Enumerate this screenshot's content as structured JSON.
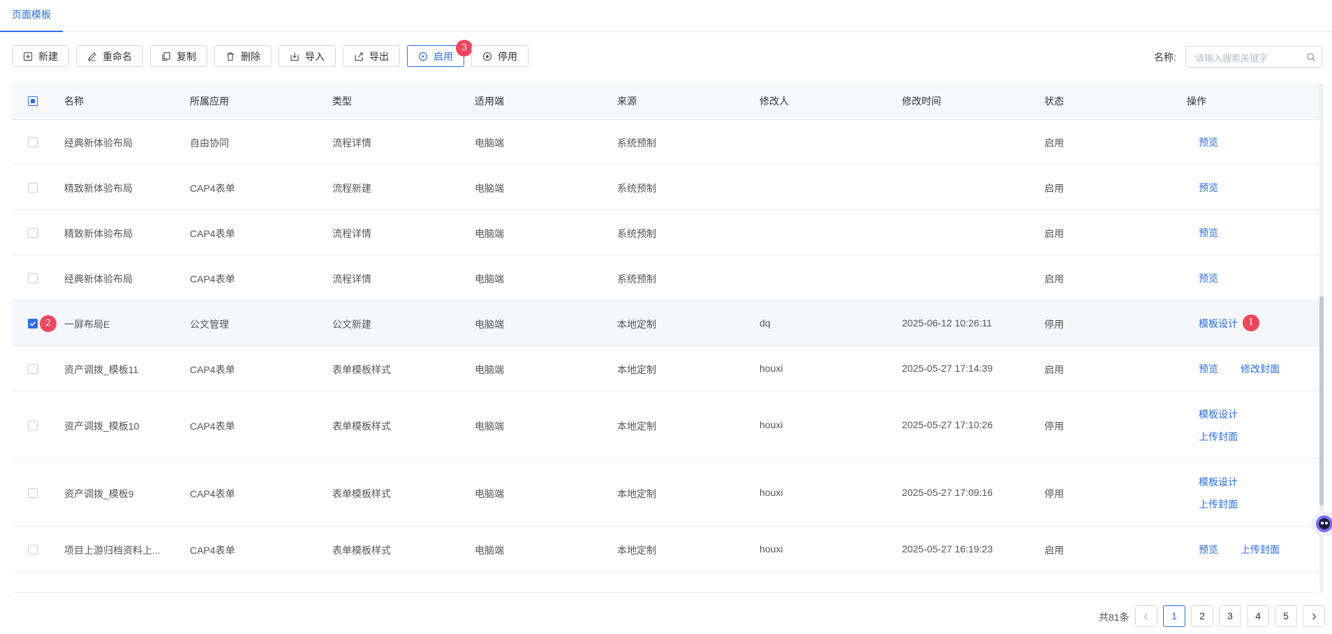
{
  "tab": {
    "label": "页面模板"
  },
  "toolbar": {
    "buttons": [
      {
        "label": "新建",
        "icon": "plus-square-icon"
      },
      {
        "label": "重命名",
        "icon": "edit-pen-icon"
      },
      {
        "label": "复制",
        "icon": "copy-icon"
      },
      {
        "label": "删除",
        "icon": "trash-icon"
      },
      {
        "label": "导入",
        "icon": "import-icon"
      },
      {
        "label": "导出",
        "icon": "export-icon"
      },
      {
        "label": "启用",
        "icon": "play-circle-icon"
      },
      {
        "label": "停用",
        "icon": "stop-circle-icon"
      }
    ]
  },
  "search": {
    "label": "名称:",
    "placeholder": "请输入搜索关键字"
  },
  "badges": {
    "enable": "3",
    "checkbox": "2",
    "design": "1"
  },
  "table": {
    "headers": [
      "名称",
      "所属应用",
      "类型",
      "适用端",
      "来源",
      "修改人",
      "修改时间",
      "状态",
      "操作"
    ],
    "rows": [
      {
        "name": "经典新体验布局",
        "app": "自由协同",
        "type": "流程详情",
        "device": "电脑端",
        "source": "系统预制",
        "modifier": "",
        "time": "",
        "status": "启用",
        "actions": [
          "预览"
        ],
        "checked": false
      },
      {
        "name": "精致新体验布局",
        "app": "CAP4表单",
        "type": "流程新建",
        "device": "电脑端",
        "source": "系统预制",
        "modifier": "",
        "time": "",
        "status": "启用",
        "actions": [
          "预览"
        ],
        "checked": false
      },
      {
        "name": "精致新体验布局",
        "app": "CAP4表单",
        "type": "流程详情",
        "device": "电脑端",
        "source": "系统预制",
        "modifier": "",
        "time": "",
        "status": "启用",
        "actions": [
          "预览"
        ],
        "checked": false
      },
      {
        "name": "经典新体验布局",
        "app": "CAP4表单",
        "type": "流程详情",
        "device": "电脑端",
        "source": "系统预制",
        "modifier": "",
        "time": "",
        "status": "启用",
        "actions": [
          "预览"
        ],
        "checked": false
      },
      {
        "name": "一屏布局E",
        "app": "公文管理",
        "type": "公文新建",
        "device": "电脑端",
        "source": "本地定制",
        "modifier": "dq",
        "time": "2025-06-12 10:26:11",
        "status": "停用",
        "actions": [
          "模板设计"
        ],
        "checked": true
      },
      {
        "name": "资产调拨_模板11",
        "app": "CAP4表单",
        "type": "表单模板样式",
        "device": "电脑端",
        "source": "本地定制",
        "modifier": "houxi",
        "time": "2025-05-27 17:14:39",
        "status": "启用",
        "actions": [
          "预览",
          "修改封面"
        ],
        "checked": false
      },
      {
        "name": "资产调拨_模板10",
        "app": "CAP4表单",
        "type": "表单模板样式",
        "device": "电脑端",
        "source": "本地定制",
        "modifier": "houxi",
        "time": "2025-05-27 17:10:26",
        "status": "停用",
        "actions": [
          "模板设计",
          "上传封面"
        ],
        "checked": false
      },
      {
        "name": "资产调拨_模板9",
        "app": "CAP4表单",
        "type": "表单模板样式",
        "device": "电脑端",
        "source": "本地定制",
        "modifier": "houxi",
        "time": "2025-05-27 17:09:16",
        "status": "停用",
        "actions": [
          "模板设计",
          "上传封面"
        ],
        "checked": false
      },
      {
        "name": "项目上游归档资料上...",
        "app": "CAP4表单",
        "type": "表单模板样式",
        "device": "电脑端",
        "source": "本地定制",
        "modifier": "houxi",
        "time": "2025-05-27 16:19:23",
        "status": "启用",
        "actions": [
          "预览",
          "上传封面"
        ],
        "checked": false
      }
    ]
  },
  "pagination": {
    "total": "共81条",
    "pages": [
      "1",
      "2",
      "3",
      "4",
      "5"
    ],
    "current": "1"
  },
  "colors": {
    "accent": "#2a6cf6",
    "badge": "#f0455b"
  }
}
